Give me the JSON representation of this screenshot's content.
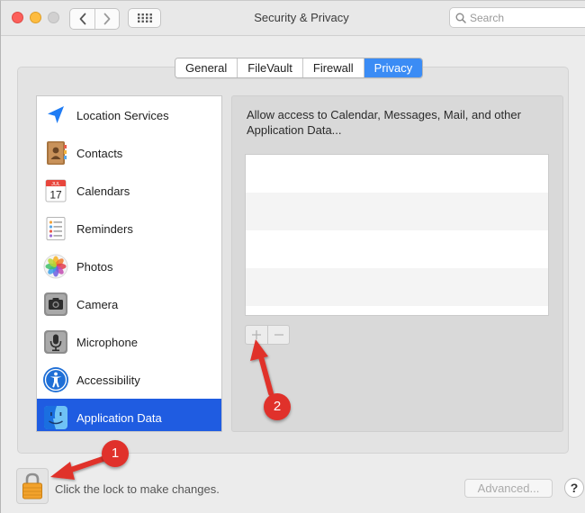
{
  "window": {
    "title": "Security & Privacy"
  },
  "search": {
    "placeholder": "Search"
  },
  "tabs": [
    {
      "label": "General",
      "active": false
    },
    {
      "label": "FileVault",
      "active": false
    },
    {
      "label": "Firewall",
      "active": false
    },
    {
      "label": "Privacy",
      "active": true
    }
  ],
  "sidebar": {
    "items": [
      {
        "label": "Location Services",
        "icon": "location-arrow-icon"
      },
      {
        "label": "Contacts",
        "icon": "contacts-book-icon"
      },
      {
        "label": "Calendars",
        "icon": "calendar-icon",
        "icon_text": "17",
        "icon_month": "JUL"
      },
      {
        "label": "Reminders",
        "icon": "reminders-list-icon"
      },
      {
        "label": "Photos",
        "icon": "photos-flower-icon"
      },
      {
        "label": "Camera",
        "icon": "camera-icon"
      },
      {
        "label": "Microphone",
        "icon": "microphone-icon"
      },
      {
        "label": "Accessibility",
        "icon": "accessibility-icon"
      },
      {
        "label": "Application Data",
        "icon": "finder-icon",
        "selected": true
      }
    ]
  },
  "panel": {
    "description": "Allow access to Calendar, Messages, Mail, and other Application Data..."
  },
  "bottom": {
    "lock_message": "Click the lock to make changes.",
    "advanced_label": "Advanced...",
    "help_label": "?"
  },
  "annotations": {
    "badge_1": "1",
    "badge_2": "2"
  },
  "colors": {
    "accent": "#3b8cf5",
    "selection": "#1f5ce1",
    "annotation": "#e0312b"
  }
}
